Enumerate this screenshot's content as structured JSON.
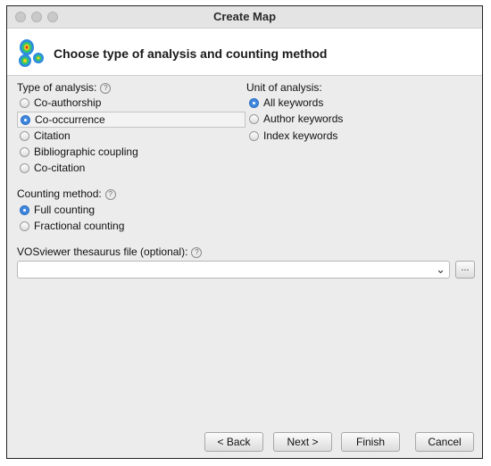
{
  "window": {
    "title": "Create Map"
  },
  "header": {
    "heading": "Choose type of analysis and counting method",
    "icon": "vosviewer-heatmap-icon"
  },
  "analysis_type": {
    "label": "Type of analysis:",
    "options": [
      "Co-authorship",
      "Co-occurrence",
      "Citation",
      "Bibliographic coupling",
      "Co-citation"
    ],
    "selected": "Co-occurrence"
  },
  "unit_of_analysis": {
    "label": "Unit of analysis:",
    "options": [
      "All keywords",
      "Author keywords",
      "Index keywords"
    ],
    "selected": "All keywords"
  },
  "counting_method": {
    "label": "Counting method:",
    "options": [
      "Full counting",
      "Fractional counting"
    ],
    "selected": "Full counting"
  },
  "thesaurus": {
    "label": "VOSviewer thesaurus file (optional):",
    "value": "",
    "browse_label": "..."
  },
  "help_icon": "?",
  "buttons": {
    "back": "< Back",
    "next": "Next >",
    "finish": "Finish",
    "cancel": "Cancel"
  }
}
